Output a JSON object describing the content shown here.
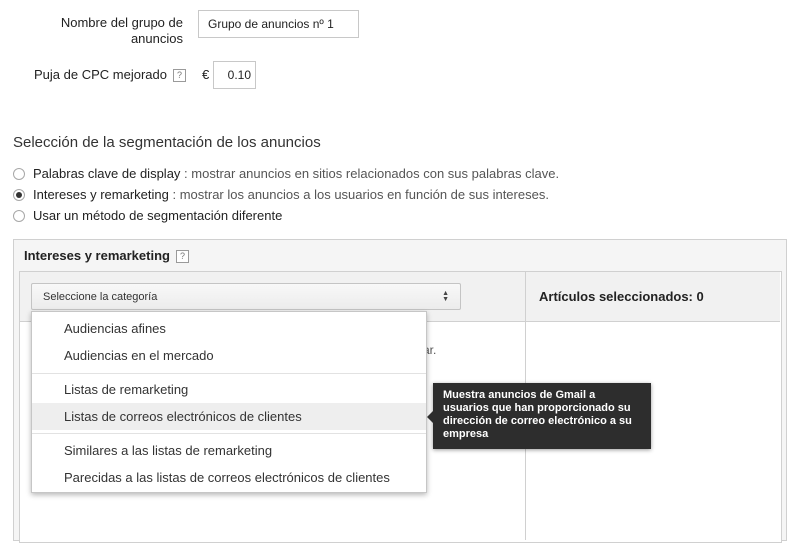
{
  "form": {
    "group_name_label": "Nombre del grupo de anuncios",
    "group_name_value": "Grupo de anuncios nº 1",
    "cpc_label": "Puja de CPC mejorado",
    "cpc_help": "?",
    "currency": "€",
    "cpc_value": "0.10"
  },
  "targeting": {
    "title": "Selección de la segmentación de los anuncios",
    "options": [
      {
        "label": "Palabras clave de display",
        "description": ": mostrar anuncios en sitios relacionados con sus palabras clave.",
        "checked": false
      },
      {
        "label": "Intereses y remarketing",
        "description": ": mostrar los anuncios a los usuarios en función de sus intereses.",
        "checked": true
      },
      {
        "label": "Usar un método de segmentación diferente",
        "description": "",
        "checked": false
      }
    ]
  },
  "panel": {
    "title": "Intereses y remarketing",
    "help": "?",
    "select_label": "Seleccione la categoría",
    "selected_header": "Artículos seleccionados: 0",
    "partial_text": "ar."
  },
  "dropdown": {
    "items": [
      "Audiencias afines",
      "Audiencias en el mercado",
      "Listas de remarketing",
      "Listas de correos electrónicos de clientes",
      "Similares a las listas de remarketing",
      "Parecidas a las listas de correos electrónicos de clientes"
    ],
    "highlighted_index": 3
  },
  "tooltip": {
    "text": "Muestra anuncios de Gmail a usuarios que han proporcionado su dirección de correo electrónico a su empresa"
  }
}
